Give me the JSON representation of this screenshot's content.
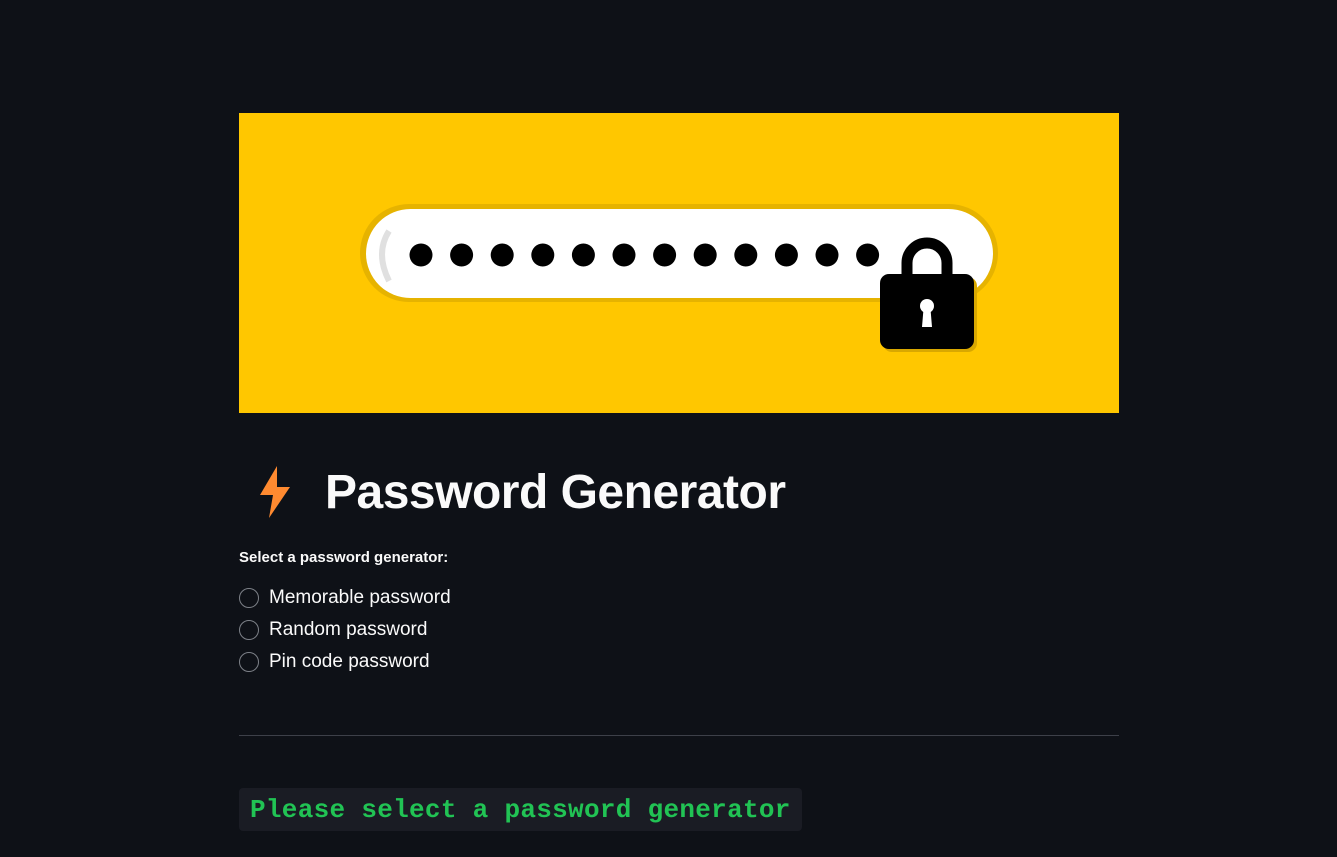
{
  "banner": {
    "icon": "password-lock-banner",
    "dot_count": 12,
    "background": "#ffc700"
  },
  "header": {
    "icon": "lightning-bolt-icon",
    "title": "Password Generator"
  },
  "generator_select": {
    "label": "Select a password generator:",
    "options": [
      "Memorable password",
      "Random password",
      "Pin code password"
    ],
    "selected": null
  },
  "status": {
    "message": "Please select a password generator",
    "color": "#21c354"
  },
  "colors": {
    "background": "#0e1117",
    "accent": "#ff8a30",
    "text": "#fafafa"
  }
}
